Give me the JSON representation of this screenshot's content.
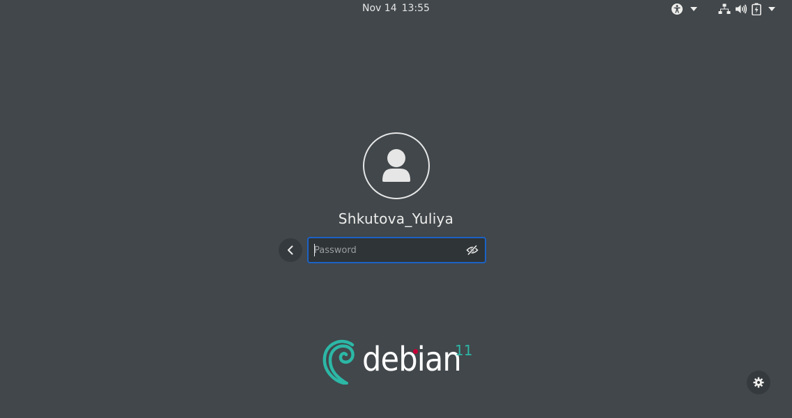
{
  "topbar": {
    "date": "Nov 14",
    "time": "13:55",
    "icons": [
      "accessibility-icon",
      "network-icon",
      "volume-icon",
      "battery-icon"
    ]
  },
  "login": {
    "username": "Shkutova_Yuliya",
    "password": {
      "value": "",
      "placeholder": "Password"
    }
  },
  "branding": {
    "word": "debian",
    "version": "11",
    "accent_color": "#2cb7a6",
    "dot_color": "#c70036"
  },
  "colors": {
    "background": "#41474b",
    "focus_border": "#1c62c5",
    "text": "#eeeeec"
  }
}
